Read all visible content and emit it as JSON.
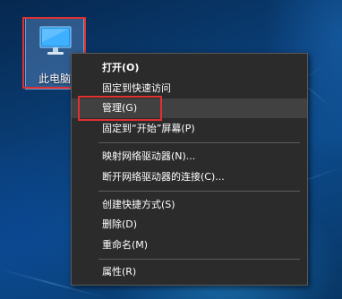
{
  "desktop": {
    "icon_label": "此电脑",
    "icon_name": "computer-icon",
    "highlight_color": "#e03030"
  },
  "context_menu": {
    "items": [
      {
        "label": "打开(O)",
        "bold": true
      },
      {
        "label": "固定到快速访问"
      },
      {
        "label": "管理(G)",
        "hovered": true
      },
      {
        "label": "固定到“开始”屏幕(P)"
      },
      {
        "label": "映射网络驱动器(N)..."
      },
      {
        "label": "断开网络驱动器的连接(C)..."
      },
      {
        "label": "创建快捷方式(S)"
      },
      {
        "label": "删除(D)"
      },
      {
        "label": "重命名(M)"
      },
      {
        "label": "属性(R)"
      }
    ],
    "background": "#2b2b2b",
    "hover_background": "#414141"
  }
}
